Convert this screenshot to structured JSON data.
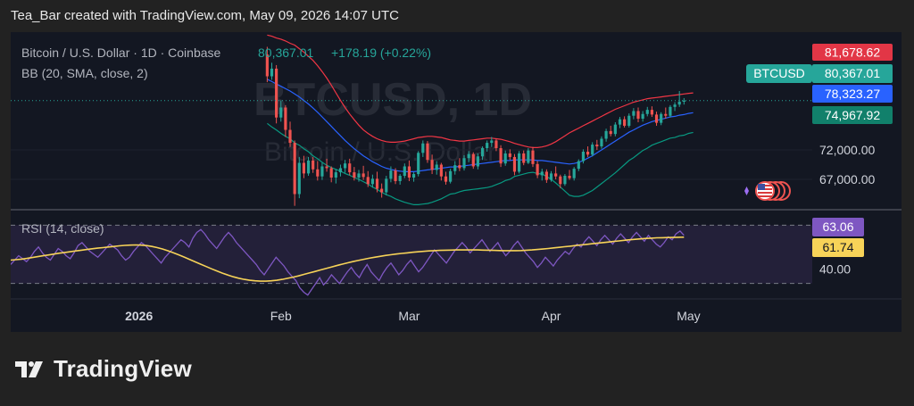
{
  "header": {
    "attribution": "Tea_Bar created with TradingView.com, May 09, 2026 14:07 UTC"
  },
  "watermark": {
    "ticker": "BTCUSD, 1D",
    "name": "Bitcoin / U.S. Dollar"
  },
  "legend": {
    "symbol": "Bitcoin / U.S. Dollar · 1D · Coinbase",
    "last": "80,367.01",
    "change": "+178.19 (+0.22%)",
    "indicator": "BB (20, SMA, close, 2)",
    "rsi": "RSI (14, close)"
  },
  "badges": {
    "upper": "81,678.62",
    "ticker": "BTCUSD",
    "last": "80,367.01",
    "basis": "78,323.27",
    "lower": "74,967.92",
    "rsi": "63.06",
    "rsi_ma": "61.74"
  },
  "footer": {
    "brand": "TradingView"
  },
  "colors": {
    "up": "#26a69a",
    "down": "#ef5350",
    "bb_upper": "#f23645",
    "bb_basis": "#2962ff",
    "bb_lower": "#089981",
    "rsi": "#7e57c2",
    "rsi_ma": "#f7d358",
    "upper_badge": "#e23646",
    "basis_badge": "#2962ff",
    "lower_badge": "#11806b",
    "last_badge": "#26a69a"
  },
  "chart_data": [
    {
      "type": "candlestick",
      "title": "Bitcoin / U.S. Dollar · 1D · Coinbase",
      "y_ticks": [
        72000,
        67000
      ],
      "y_tick_labels": [
        "72,000.00",
        "67,000.00"
      ],
      "ylim": [
        62000,
        92000
      ],
      "x_ticks": [
        "2026",
        "Feb",
        "Mar",
        "Apr",
        "May"
      ],
      "x_tick_dates": [
        "2026-01-01",
        "2026-02-01",
        "2026-03-01",
        "2026-04-01",
        "2026-05-01"
      ],
      "xlim": [
        "2025-12-04",
        "2026-05-28"
      ],
      "first_candle_date": "2026-01-29",
      "candles": [
        [
          88200,
          89500,
          83500,
          84500
        ],
        [
          84500,
          86800,
          83900,
          85800
        ],
        [
          85800,
          86400,
          76500,
          77500
        ],
        [
          77500,
          80400,
          76800,
          79200
        ],
        [
          79200,
          79600,
          74200,
          75400
        ],
        [
          75400,
          76800,
          72500,
          73200
        ],
        [
          73200,
          73600,
          62500,
          64500
        ],
        [
          64500,
          70800,
          63800,
          69800
        ],
        [
          69800,
          71000,
          67200,
          68000
        ],
        [
          68000,
          70800,
          67600,
          70200
        ],
        [
          70200,
          70800,
          68100,
          68700
        ],
        [
          68700,
          70100,
          66800,
          67500
        ],
        [
          67500,
          69800,
          66900,
          69200
        ],
        [
          69200,
          70500,
          68300,
          68900
        ],
        [
          68900,
          69200,
          66500,
          67300
        ],
        [
          67300,
          68700,
          66300,
          68200
        ],
        [
          68200,
          69500,
          67500,
          68900
        ],
        [
          68900,
          70300,
          68100,
          69700
        ],
        [
          69700,
          70500,
          67700,
          68200
        ],
        [
          68200,
          69100,
          66800,
          67300
        ],
        [
          67300,
          68600,
          66600,
          68000
        ],
        [
          68000,
          69300,
          66900,
          67400
        ],
        [
          67400,
          68400,
          65700,
          66200
        ],
        [
          66200,
          67800,
          65600,
          67100
        ],
        [
          67100,
          68300,
          64800,
          65400
        ],
        [
          65400,
          66300,
          63900,
          64800
        ],
        [
          64800,
          67600,
          64300,
          67100
        ],
        [
          67100,
          69200,
          66500,
          68500
        ],
        [
          68500,
          68900,
          66200,
          66700
        ],
        [
          66700,
          67900,
          66100,
          67600
        ],
        [
          67600,
          69700,
          67200,
          69200
        ],
        [
          69200,
          70200,
          66700,
          67300
        ],
        [
          67300,
          68200,
          66600,
          67900
        ],
        [
          67900,
          71800,
          67500,
          71500
        ],
        [
          71500,
          73600,
          70800,
          73100
        ],
        [
          73100,
          73500,
          69800,
          70300
        ],
        [
          70300,
          71200,
          67900,
          68600
        ],
        [
          68600,
          70100,
          67800,
          69500
        ],
        [
          69500,
          69800,
          66800,
          67500
        ],
        [
          67500,
          68300,
          66100,
          66600
        ],
        [
          66600,
          68800,
          66300,
          68400
        ],
        [
          68400,
          70100,
          67800,
          69400
        ],
        [
          69400,
          70600,
          68400,
          68900
        ],
        [
          68900,
          71100,
          68500,
          70600
        ],
        [
          70600,
          71800,
          69900,
          71300
        ],
        [
          71300,
          71600,
          68800,
          69200
        ],
        [
          69200,
          71400,
          68700,
          70900
        ],
        [
          70900,
          72600,
          70300,
          72300
        ],
        [
          72300,
          73600,
          71700,
          73200
        ],
        [
          73200,
          74200,
          72500,
          73600
        ],
        [
          73600,
          73900,
          71800,
          72300
        ],
        [
          72300,
          72800,
          69100,
          69700
        ],
        [
          69700,
          71900,
          69300,
          71400
        ],
        [
          71400,
          72100,
          70300,
          70800
        ],
        [
          70800,
          71300,
          67700,
          68300
        ],
        [
          68300,
          71800,
          68000,
          71400
        ],
        [
          71400,
          71900,
          69400,
          69800
        ],
        [
          69800,
          72300,
          69600,
          71900
        ],
        [
          71900,
          72500,
          69100,
          69600
        ],
        [
          69600,
          70100,
          67200,
          67700
        ],
        [
          67700,
          68800,
          66800,
          68300
        ],
        [
          68300,
          68700,
          66400,
          66900
        ],
        [
          66900,
          68400,
          66600,
          68000
        ],
        [
          68000,
          69200,
          67000,
          67500
        ],
        [
          67500,
          67800,
          65500,
          66200
        ],
        [
          66200,
          67900,
          65900,
          67600
        ],
        [
          67600,
          68600,
          66900,
          67200
        ],
        [
          67200,
          69100,
          66800,
          68800
        ],
        [
          68800,
          70400,
          68400,
          70100
        ],
        [
          70100,
          72100,
          69700,
          71700
        ],
        [
          71700,
          72600,
          70800,
          71200
        ],
        [
          71200,
          73300,
          70900,
          72900
        ],
        [
          72900,
          73700,
          72000,
          72600
        ],
        [
          72600,
          74300,
          72200,
          73900
        ],
        [
          73900,
          75600,
          73400,
          75200
        ],
        [
          75200,
          76100,
          74300,
          74700
        ],
        [
          74700,
          76700,
          74300,
          76300
        ],
        [
          76300,
          77600,
          75700,
          77200
        ],
        [
          77200,
          77700,
          75800,
          76100
        ],
        [
          76100,
          78200,
          75800,
          77800
        ],
        [
          77800,
          79100,
          77200,
          78600
        ],
        [
          78600,
          79200,
          76700,
          77300
        ],
        [
          77300,
          78600,
          76800,
          78100
        ],
        [
          78100,
          79300,
          77700,
          78800
        ],
        [
          78800,
          79400,
          77600,
          78000
        ],
        [
          78000,
          78500,
          76100,
          76600
        ],
        [
          76600,
          78400,
          76200,
          78100
        ],
        [
          78100,
          79200,
          77300,
          77800
        ],
        [
          77800,
          79600,
          77500,
          79300
        ],
        [
          79300,
          80100,
          78600,
          79700
        ],
        [
          79700,
          82000,
          79300,
          80189
        ],
        [
          80189,
          80800,
          79700,
          80367.01
        ]
      ],
      "bb_upper": [
        91500,
        91300,
        91000,
        90800,
        90500,
        90100,
        89800,
        89200,
        88600,
        87900,
        87200,
        86300,
        85300,
        84200,
        83000,
        81700,
        80400,
        79200,
        78100,
        77100,
        76200,
        75400,
        74800,
        74300,
        73900,
        73600,
        73400,
        73300,
        73300,
        73400,
        73500,
        73700,
        73900,
        74100,
        74200,
        74300,
        74300,
        74200,
        74100,
        73900,
        73700,
        73600,
        73500,
        73500,
        73600,
        73700,
        73800,
        73900,
        74000,
        74000,
        73900,
        73800,
        73600,
        73400,
        73100,
        72900,
        72700,
        72500,
        72400,
        72400,
        72500,
        72700,
        73000,
        73400,
        73900,
        74400,
        74900,
        75300,
        75700,
        76100,
        76500,
        76900,
        77300,
        77700,
        78100,
        78500,
        78900,
        79200,
        79500,
        79800,
        80100,
        80300,
        80500,
        80700,
        80800,
        80900,
        81000,
        81100,
        81200,
        81300,
        81400,
        81500,
        81600,
        81678.62
      ],
      "bb_basis": [
        84000,
        83600,
        83200,
        82800,
        82400,
        82000,
        81500,
        81000,
        80400,
        79800,
        79100,
        78400,
        77600,
        76800,
        76000,
        75200,
        74400,
        73600,
        72900,
        72200,
        71600,
        71000,
        70500,
        70000,
        69600,
        69200,
        68900,
        68700,
        68500,
        68400,
        68300,
        68300,
        68300,
        68400,
        68500,
        68600,
        68700,
        68800,
        68900,
        69000,
        69100,
        69100,
        69200,
        69300,
        69400,
        69500,
        69600,
        69700,
        69800,
        69900,
        70000,
        70100,
        70200,
        70200,
        70300,
        70300,
        70300,
        70300,
        70300,
        70200,
        70200,
        70100,
        70000,
        69900,
        69800,
        69700,
        69600,
        69700,
        69900,
        70200,
        70600,
        71000,
        71500,
        72000,
        72500,
        73000,
        73500,
        74000,
        74500,
        75000,
        75400,
        75800,
        76200,
        76500,
        76800,
        77000,
        77200,
        77400,
        77600,
        77700,
        77900,
        78000,
        78200,
        78323.27
      ],
      "bb_lower": [
        76500,
        75900,
        75400,
        74800,
        74300,
        73900,
        73200,
        72800,
        72200,
        71700,
        71000,
        70500,
        69900,
        69400,
        69000,
        68700,
        68400,
        68000,
        67700,
        67300,
        67000,
        66600,
        66200,
        65700,
        65300,
        64800,
        64400,
        64100,
        63700,
        63400,
        63100,
        62900,
        62700,
        62700,
        62800,
        62900,
        63100,
        63400,
        63700,
        64100,
        64500,
        64600,
        64900,
        65100,
        65200,
        65300,
        65400,
        65500,
        65600,
        65800,
        66100,
        66400,
        66800,
        67000,
        67500,
        67700,
        67900,
        68100,
        68200,
        68000,
        67900,
        67500,
        67000,
        66400,
        65700,
        65000,
        64300,
        64100,
        64100,
        64300,
        64700,
        65100,
        65700,
        66300,
        66900,
        67500,
        68100,
        68800,
        69500,
        70200,
        70700,
        71300,
        71900,
        72300,
        72800,
        73100,
        73400,
        73700,
        74000,
        74100,
        74400,
        74500,
        74800,
        74967.92
      ]
    },
    {
      "type": "line",
      "title": "RSI (14, close)",
      "y_ticks": [
        40
      ],
      "y_tick_labels": [
        "40.00"
      ],
      "ylim": [
        20,
        80
      ],
      "bands": [
        70,
        30
      ],
      "first_rsi_date": "2025-12-04",
      "first_ma_date": "2025-12-04",
      "series": [
        {
          "name": "RSI",
          "values": [
            43,
            46,
            49,
            47,
            45,
            48,
            52,
            55,
            51,
            48,
            46,
            50,
            54,
            52,
            49,
            47,
            51,
            56,
            58,
            55,
            52,
            50,
            48,
            51,
            54,
            57,
            55,
            53,
            49,
            46,
            48,
            52,
            55,
            58,
            56,
            53,
            50,
            47,
            44,
            48,
            51,
            54,
            57,
            60,
            58,
            55,
            61,
            65,
            67,
            64,
            60,
            57,
            54,
            58,
            62,
            65,
            62,
            58,
            55,
            52,
            49,
            46,
            43,
            39,
            36,
            40,
            44,
            48,
            45,
            42,
            38,
            35,
            32,
            27,
            24,
            22,
            26,
            30,
            34,
            29,
            32,
            36,
            33,
            30,
            34,
            38,
            41,
            37,
            34,
            39,
            43,
            38,
            35,
            32,
            37,
            41,
            44,
            40,
            36,
            39,
            43,
            46,
            42,
            38,
            41,
            45,
            49,
            53,
            50,
            47,
            44,
            48,
            52,
            55,
            58,
            55,
            51,
            54,
            57,
            60,
            56,
            52,
            55,
            58,
            53,
            49,
            52,
            56,
            59,
            55,
            51,
            48,
            45,
            41,
            44,
            48,
            45,
            42,
            46,
            49,
            52,
            50,
            54,
            57,
            55,
            59,
            62,
            59,
            56,
            60,
            63,
            60,
            57,
            61,
            64,
            61,
            58,
            62,
            65,
            62,
            59,
            63,
            60,
            57,
            55,
            58,
            62,
            60,
            64,
            66,
            63.06
          ]
        },
        {
          "name": "RSI-based MA",
          "values": [
            46,
            46.3,
            46.7,
            47.2,
            47.8,
            48.4,
            49,
            49.6,
            50.2,
            50.8,
            51.3,
            51.8,
            52.3,
            52.8,
            53.3,
            53.8,
            54.2,
            54.6,
            55,
            55.4,
            55.8,
            56.1,
            56.3,
            56.4,
            56.3,
            56,
            55.4,
            54.6,
            53.6,
            52.4,
            51,
            49.5,
            48,
            46.4,
            44.8,
            43.2,
            41.6,
            40,
            38.5,
            37.1,
            35.8,
            34.6,
            33.6,
            32.8,
            32.2,
            31.8,
            31.6,
            31.6,
            31.8,
            32.2,
            32.8,
            33.5,
            34.3,
            35.2,
            36.2,
            37.2,
            38.2,
            39.2,
            40.2,
            41.2,
            42.2,
            43.2,
            44.1,
            45,
            45.8,
            46.6,
            47.3,
            48,
            48.6,
            49.2,
            49.7,
            50.2,
            50.6,
            51,
            51.4,
            51.7,
            52,
            52.3,
            52.5,
            52.7,
            52.8,
            52.9,
            53,
            53,
            53,
            53,
            53,
            52.9,
            52.8,
            52.7,
            52.6,
            52.5,
            52.5,
            52.5,
            52.6,
            52.8,
            53,
            53.3,
            53.6,
            54,
            54.4,
            54.8,
            55.2,
            55.6,
            56,
            56.4,
            56.8,
            57.2,
            57.6,
            58,
            58.4,
            58.8,
            59.2,
            59.6,
            60,
            60.3,
            60.6,
            60.9,
            61.1,
            61.3,
            61.4,
            61.5,
            61.6,
            61.7,
            61.74
          ]
        }
      ]
    }
  ]
}
